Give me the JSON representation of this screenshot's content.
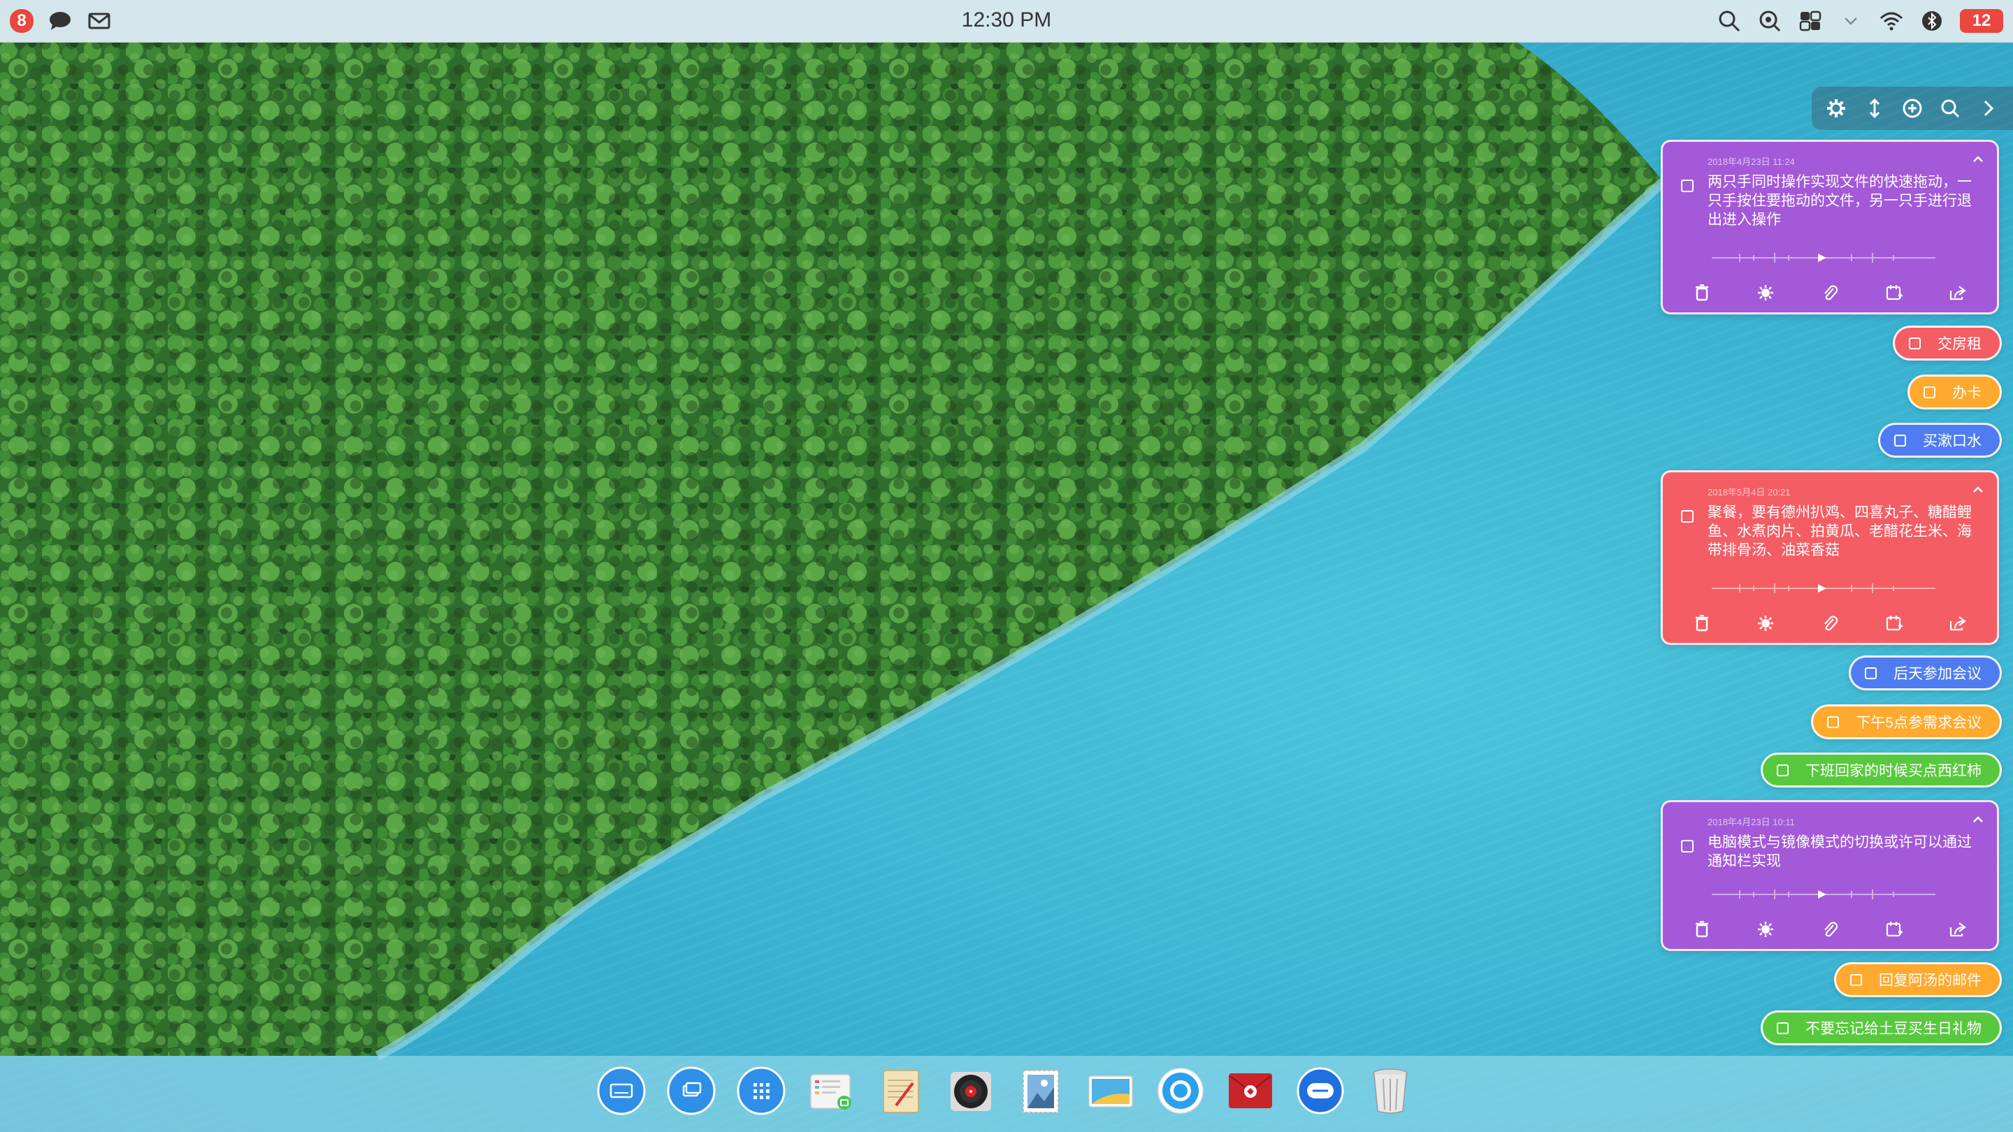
{
  "statusbar": {
    "notification_count": "8",
    "clock": "12:30 PM",
    "battery": "12"
  },
  "notes": [
    {
      "type": "card",
      "color": "purple",
      "date": "2018年4月23日 11:24",
      "text": "两只手同时操作实现文件的快速拖动，一只手按住要拖动的文件，另一只手进行退出进入操作"
    },
    {
      "type": "pill",
      "color": "red",
      "text": "交房租"
    },
    {
      "type": "pill",
      "color": "orange",
      "text": "办卡"
    },
    {
      "type": "pill",
      "color": "blue",
      "text": "买漱口水"
    },
    {
      "type": "card",
      "color": "red",
      "date": "2018年5月4日 20:21",
      "text": "聚餐，要有德州扒鸡、四喜丸子、糖醋鲤鱼、水煮肉片、拍黄瓜、老醋花生米、海带排骨汤、油菜香菇"
    },
    {
      "type": "pill",
      "color": "blue",
      "text": "后天参加会议"
    },
    {
      "type": "pill",
      "color": "orange",
      "text": "下午5点参需求会议"
    },
    {
      "type": "pill",
      "color": "green",
      "text": "下班回家的时候买点西红柿"
    },
    {
      "type": "card",
      "color": "purple",
      "date": "2018年4月23日 10:11",
      "text": "电脑模式与镜像模式的切换或许可以通过通知栏实现"
    },
    {
      "type": "pill",
      "color": "orange",
      "text": "回复阿汤的邮件"
    },
    {
      "type": "pill",
      "color": "green",
      "text": "不要忘记给土豆买生日礼物"
    }
  ],
  "colors": {
    "purple": "#a359d8",
    "red": "#f45d64",
    "orange": "#ffa92e",
    "blue": "#4f7df1",
    "green": "#58c93f"
  },
  "toolbar_icons": [
    "gear-icon",
    "resize-vertical-icon",
    "add-icon",
    "search-icon",
    "chevron-right-icon"
  ],
  "card_action_icons": [
    "trash-icon",
    "color-icon",
    "attachment-icon",
    "calendar-icon",
    "share-icon"
  ],
  "dock_icons": [
    "keyboard-icon",
    "windows-icon",
    "launcher-icon",
    "file-manager-icon",
    "notes-icon",
    "music-player-icon",
    "stamp-photo-icon",
    "gallery-icon",
    "browser-icon",
    "mail-icon",
    "chat-icon",
    "trash-bin-icon"
  ]
}
